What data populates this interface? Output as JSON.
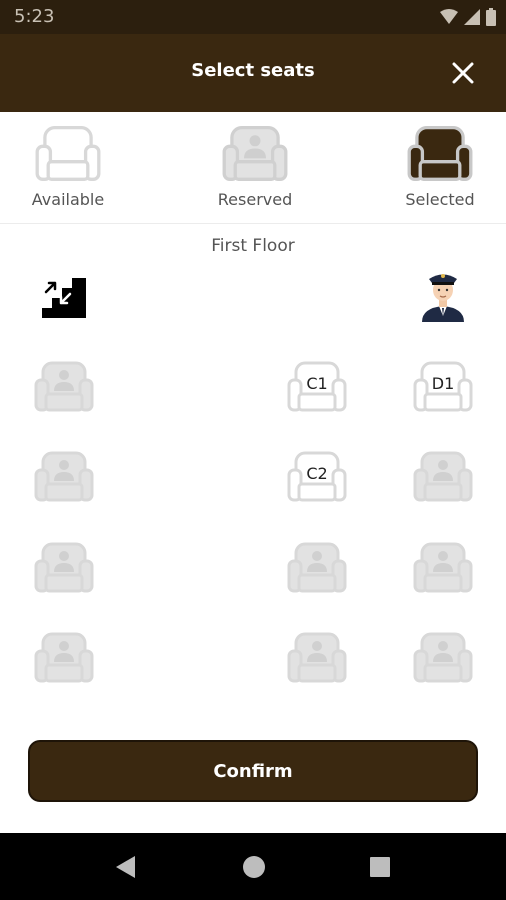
{
  "status_bar": {
    "time": "5:23"
  },
  "header": {
    "title": "Select seats"
  },
  "legend": {
    "available": "Available",
    "reserved": "Reserved",
    "selected": "Selected"
  },
  "floor": {
    "label": "First Floor"
  },
  "seats": {
    "C1": "C1",
    "D1": "D1",
    "C2": "C2"
  },
  "confirm": {
    "label": "Confirm"
  },
  "colors": {
    "brand": "#3a2810",
    "reserved_gray": "#e2e2e2",
    "status_bar": "#2c1f0e"
  }
}
